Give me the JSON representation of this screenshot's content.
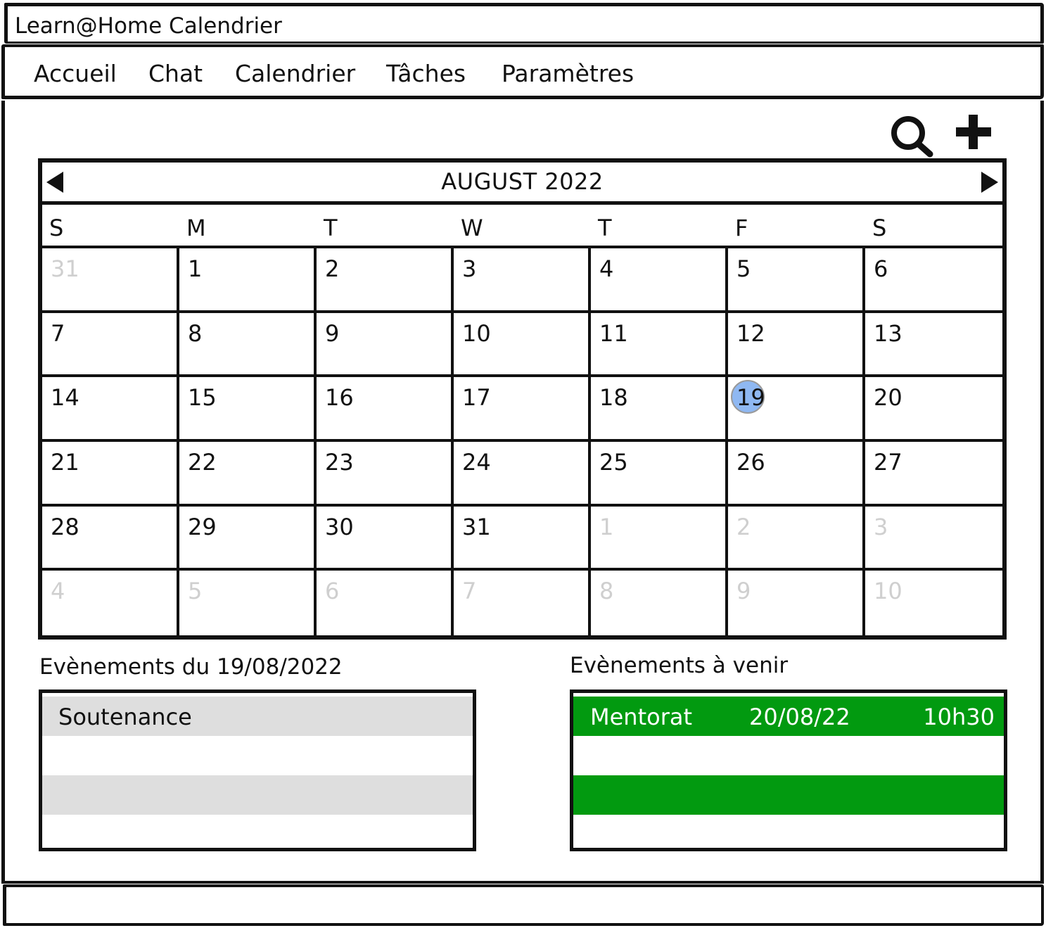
{
  "app": {
    "title": "Learn@Home Calendrier"
  },
  "nav": {
    "items": [
      "Accueil",
      "Chat",
      "Calendrier",
      "Tâches",
      "Paramètres"
    ]
  },
  "toolbar": {
    "search_icon": "search-icon",
    "add_icon": "plus-icon"
  },
  "calendar": {
    "month_title": "AUGUST 2022",
    "weekdays": [
      "S",
      "M",
      "T",
      "W",
      "T",
      "F",
      "S"
    ],
    "selected_day": "19",
    "highlight_color": "#8fb8f2",
    "weeks": [
      [
        "31",
        "1",
        "2",
        "3",
        "4",
        "5",
        "6"
      ],
      [
        "7",
        "8",
        "9",
        "10",
        "11",
        "12",
        "13"
      ],
      [
        "14",
        "15",
        "16",
        "17",
        "18",
        "19",
        "20"
      ],
      [
        "21",
        "22",
        "23",
        "24",
        "25",
        "26",
        "27"
      ],
      [
        "28",
        "29",
        "30",
        "31",
        "1",
        "2",
        "3"
      ],
      [
        "4",
        "5",
        "6",
        "7",
        "8",
        "9",
        "10"
      ]
    ]
  },
  "day_events": {
    "title": "Evènements du 19/08/2022",
    "items": [
      {
        "name": "Soutenance"
      }
    ]
  },
  "upcoming": {
    "title": "Evènements à venir",
    "accent_color": "#029a10",
    "items": [
      {
        "name": "Mentorat",
        "date": "20/08/22",
        "time": "10h30"
      }
    ]
  }
}
